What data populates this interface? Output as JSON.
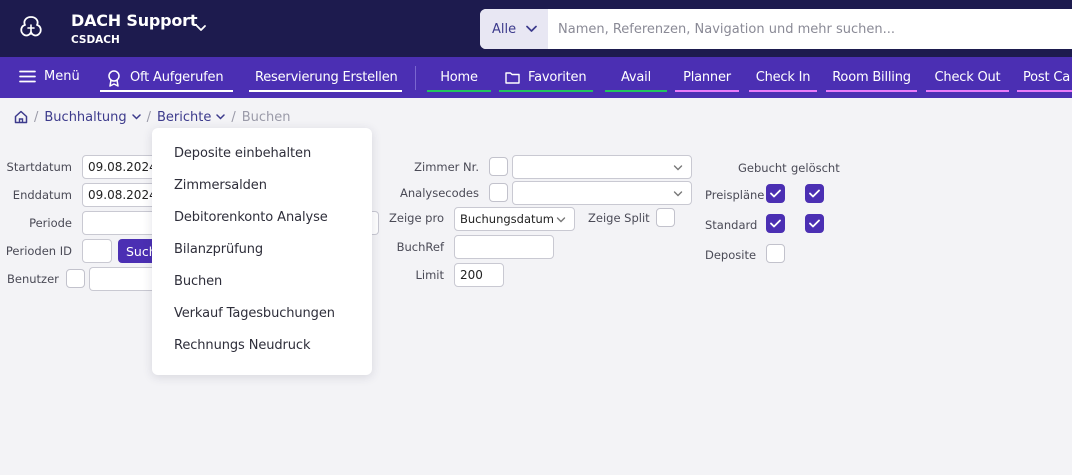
{
  "header": {
    "org_name": "DACH Support",
    "org_code": "CSDACH",
    "search_scope": "Alle",
    "search_placeholder": "Namen, Referenzen, Navigation und mehr suchen..."
  },
  "nav": {
    "menu_label": "Menü",
    "left_items": [
      {
        "label": "Oft Aufgerufen",
        "icon": "award-icon",
        "underline": "#ffffff"
      },
      {
        "label": "Reservierung Erstellen",
        "underline": "#ffffff"
      }
    ],
    "items": [
      {
        "label": "Home",
        "underline": "#22c55e"
      },
      {
        "label": "Favoriten",
        "icon": "folder-icon",
        "underline": "#22c55e"
      },
      {
        "label": "Avail",
        "underline": "#22c55e"
      },
      {
        "label": "Planner",
        "underline": "#e879f9"
      },
      {
        "label": "Check In",
        "underline": "#e879f9"
      },
      {
        "label": "Room Billing",
        "underline": "#e879f9"
      },
      {
        "label": "Check Out",
        "underline": "#e879f9"
      },
      {
        "label": "Post Ca",
        "underline": "#e879f9"
      }
    ]
  },
  "breadcrumb": {
    "items": [
      "Buchhaltung",
      "Berichte"
    ],
    "current": "Buchen"
  },
  "dropdown": {
    "items": [
      "Deposite einbehalten",
      "Zimmersalden",
      "Debitorenkonto Analyse",
      "Bilanzprüfung",
      "Buchen",
      "Verkauf Tagesbuchungen",
      "Rechnungs Neudruck"
    ]
  },
  "form": {
    "startdatum_label": "Startdatum",
    "startdatum_value": "09.08.2024",
    "enddatum_label": "Enddatum",
    "enddatum_value": "09.08.2024",
    "periode_label": "Periode",
    "perioden_id_label": "Perioden ID",
    "search_button": "Suchen",
    "benutzer_label": "Benutzer",
    "zimmer_label": "Zimmer Nr.",
    "analysecodes_label": "Analysecodes",
    "zeige_pro_label": "Zeige pro",
    "zeige_pro_value": "Buchungsdatum",
    "zeige_split_label": "Zeige Split",
    "buchref_label": "BuchRef",
    "limit_label": "Limit",
    "limit_value": "200",
    "col_gebucht": "Gebucht",
    "col_geloescht": "gelöscht",
    "preisplaene_label": "Preispläne",
    "standard_label": "Standard",
    "deposite_label": "Deposite"
  }
}
